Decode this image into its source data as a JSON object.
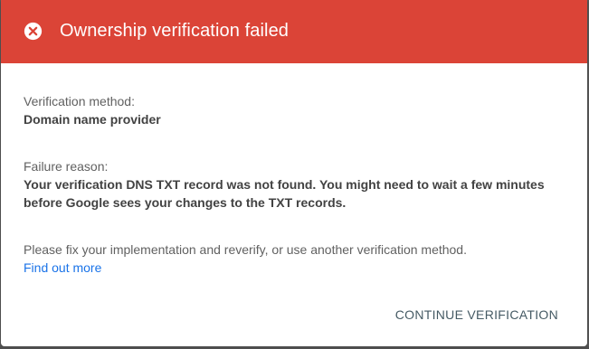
{
  "dialog": {
    "title": "Ownership verification failed",
    "header_color": "#db4437",
    "header_icon": "error-circle-icon",
    "method": {
      "label": "Verification method:",
      "value": "Domain name provider"
    },
    "failure": {
      "label": "Failure reason:",
      "value": "Your verification DNS TXT record was not found. You might need to wait a few minutes before Google sees your changes to the TXT records."
    },
    "help_text": "Please fix your implementation and reverify, or use another verification method.",
    "link_label": "Find out more",
    "link_color": "#1a73e8",
    "continue_label": "CONTINUE VERIFICATION"
  }
}
